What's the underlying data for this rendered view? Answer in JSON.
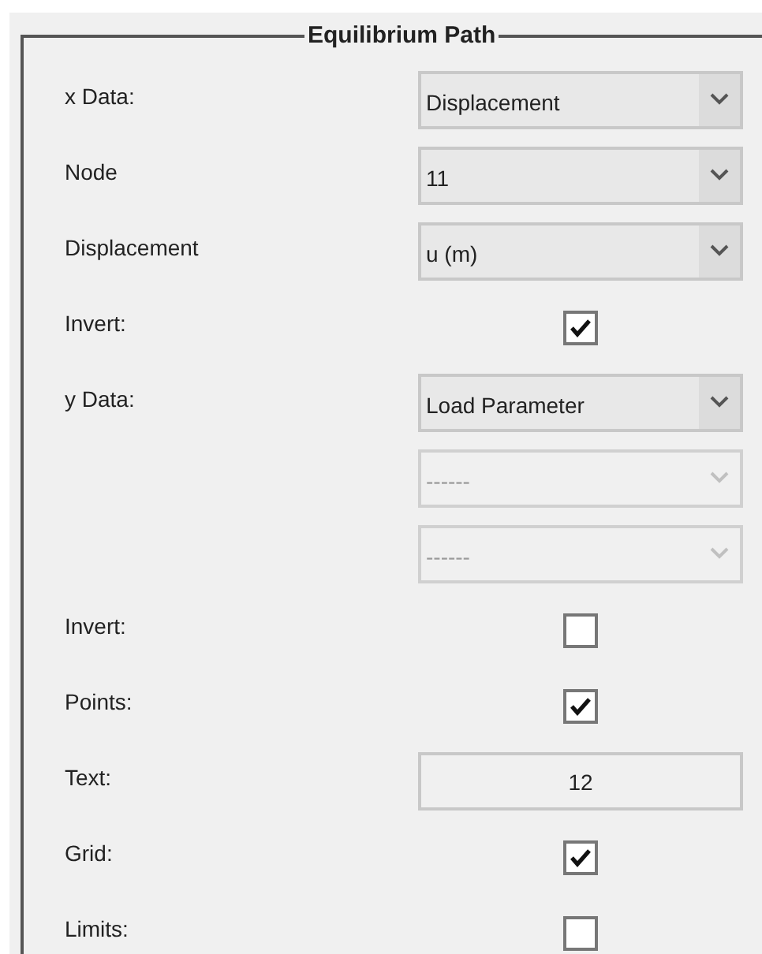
{
  "panel": {
    "title": "Equilibrium Path"
  },
  "rows": [
    {
      "kind": "dropdown",
      "label": "x Data:",
      "value": "Displacement",
      "disabled": false
    },
    {
      "kind": "dropdown",
      "label": "Node",
      "value": "11",
      "disabled": false
    },
    {
      "kind": "dropdown",
      "label": "Displacement",
      "value": "u (m)",
      "disabled": false
    },
    {
      "kind": "checkbox",
      "label": "Invert:",
      "checked": true
    },
    {
      "kind": "dropdown",
      "label": "y Data:",
      "value": "Load Parameter",
      "disabled": false
    },
    {
      "kind": "dropdown",
      "value": "------",
      "disabled": true
    },
    {
      "kind": "dropdown",
      "value": "------",
      "disabled": true
    },
    {
      "kind": "checkbox",
      "label": "Invert:",
      "checked": false
    },
    {
      "kind": "checkbox",
      "label": "Points:",
      "checked": true
    },
    {
      "kind": "text",
      "label": "Text:",
      "value": "12"
    },
    {
      "kind": "checkbox",
      "label": "Grid:",
      "checked": true
    },
    {
      "kind": "checkbox",
      "label": "Limits:",
      "checked": false
    }
  ]
}
